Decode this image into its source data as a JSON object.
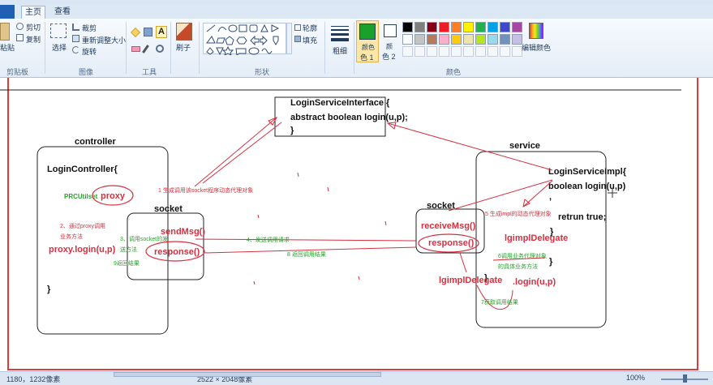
{
  "menu": {
    "home_tab": "主页",
    "view_tab": "查看"
  },
  "clipboard": {
    "paste": "粘贴",
    "cut": "剪切",
    "copy": "复制",
    "group": "剪贴板"
  },
  "image": {
    "select": "选择",
    "crop": "裁剪",
    "resize": "重新调整大小",
    "rotate": "旋转",
    "group": "图像"
  },
  "tools": {
    "group": "工具"
  },
  "brushes": {
    "label": "刷子"
  },
  "shapes": {
    "outline": "轮廓",
    "fill": "填充",
    "group": "形状"
  },
  "size_tool": {
    "label": "粗细"
  },
  "colors": {
    "color1_label": "颜色",
    "color1_sub": "色 1",
    "color2_label": "颜",
    "color2_sub": "色 2",
    "edit_colors": "编辑颜色",
    "group": "颜色",
    "color1_value": "#1aa12c",
    "color2_value": "#ffffff",
    "palette_row1": [
      "#000000",
      "#7f7f7f",
      "#880015",
      "#ed1c24",
      "#ff7f27",
      "#fff200",
      "#22b14c",
      "#00a2e8",
      "#3f48cc",
      "#a349a4"
    ],
    "palette_row2": [
      "#ffffff",
      "#c3c3c3",
      "#b97a57",
      "#ffaec9",
      "#ffc90e",
      "#efe4b0",
      "#b5e61d",
      "#99d9ea",
      "#7092be",
      "#c8bfe7"
    ],
    "accent_red": "#e03a3a"
  },
  "diagram": {
    "interface_line1": "LoginServiceInterface {",
    "interface_line2": "abstract boolean login(u,p);",
    "interface_line3": "}",
    "controller_title": "controller",
    "controller_class": "LoginController{",
    "prcutil": "PRCUtilset",
    "proxy": "proxy",
    "step1": "1 生成调用该socket程序动态代理对象",
    "step2": "2、通过proxy调用",
    "step2b": "业务方法",
    "proxy_login": "proxy.login(u,p)",
    "controller_close": "}",
    "socket_left_title": "socket",
    "send_msg": "sendMsg()",
    "step3": "3、调用socket的发",
    "step3b": "送方法",
    "response_left": "response()",
    "step9": "9返回结果",
    "step4": "4、发送调用请求",
    "step8": "8 返回调用结果",
    "service_title": "service",
    "service_impl": "LoginServiceImpl{",
    "service_bool": "boolean login(u,p)",
    "service_comma": ",",
    "retrun_true": "retrun true;",
    "service_brace1": "}",
    "service_brace2": "}",
    "socket_right_title": "socket",
    "receive_msg": "receiveMsg()",
    "response_right": "response()",
    "step5": "5 生成impl的动态代理对象",
    "delegate1": "lgimplDelegate",
    "step6": "6调用业务代理对象",
    "step6b": "的具体业务方法",
    "delegate2": "lgimplDelegate",
    "delegate_login": ".login(u,p)",
    "step7": "7获取调用结果",
    "close_right": "}"
  },
  "status": {
    "cursor_pos": "1180，1232像素",
    "image_size": "2522 × 2048像素",
    "zoom": "100%"
  }
}
